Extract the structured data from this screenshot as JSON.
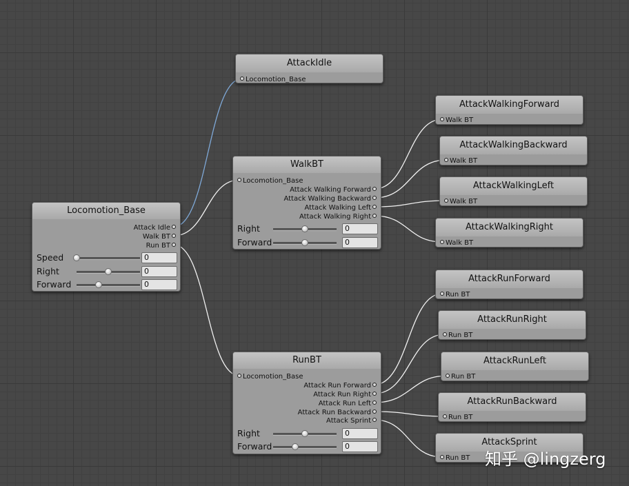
{
  "nodes": {
    "locomotion_base": {
      "title": "Locomotion_Base",
      "outputs": [
        "Attack Idle",
        "Walk BT",
        "Run BT"
      ],
      "params": [
        {
          "label": "Speed",
          "value": "0",
          "slider": 0.0
        },
        {
          "label": "Right",
          "value": "0",
          "slider": 0.5
        },
        {
          "label": "Forward",
          "value": "0",
          "slider": 0.35
        }
      ]
    },
    "attack_idle": {
      "title": "AttackIdle",
      "input": "Locomotion_Base"
    },
    "walk_bt": {
      "title": "WalkBT",
      "input": "Locomotion_Base",
      "outputs": [
        "Attack Walking Forward",
        "Attack Walking Backward",
        "Attack Walking Left",
        "Attack Walking Right"
      ],
      "params": [
        {
          "label": "Right",
          "value": "0",
          "slider": 0.5
        },
        {
          "label": "Forward",
          "value": "0",
          "slider": 0.5
        }
      ]
    },
    "run_bt": {
      "title": "RunBT",
      "input": "Locomotion_Base",
      "outputs": [
        "Attack Run Forward",
        "Attack Run Right",
        "Attack Run Left",
        "Attack Run Backward",
        "Attack Sprint"
      ],
      "params": [
        {
          "label": "Right",
          "value": "0",
          "slider": 0.5
        },
        {
          "label": "Forward",
          "value": "0",
          "slider": 0.35
        }
      ]
    },
    "walk_children": [
      {
        "title": "AttackWalkingForward",
        "input": "Walk BT"
      },
      {
        "title": "AttackWalkingBackward",
        "input": "Walk BT"
      },
      {
        "title": "AttackWalkingLeft",
        "input": "Walk BT"
      },
      {
        "title": "AttackWalkingRight",
        "input": "Walk BT"
      }
    ],
    "run_children": [
      {
        "title": "AttackRunForward",
        "input": "Run BT"
      },
      {
        "title": "AttackRunRight",
        "input": "Run BT"
      },
      {
        "title": "AttackRunLeft",
        "input": "Run BT"
      },
      {
        "title": "AttackRunBackward",
        "input": "Run BT"
      },
      {
        "title": "AttackSprint",
        "input": "Run BT"
      }
    ]
  },
  "colors": {
    "wire": "#f2f2f2",
    "wire_selected": "#7fa9d8",
    "canvas": "#474747"
  },
  "watermark": "知乎 @lingzerg"
}
